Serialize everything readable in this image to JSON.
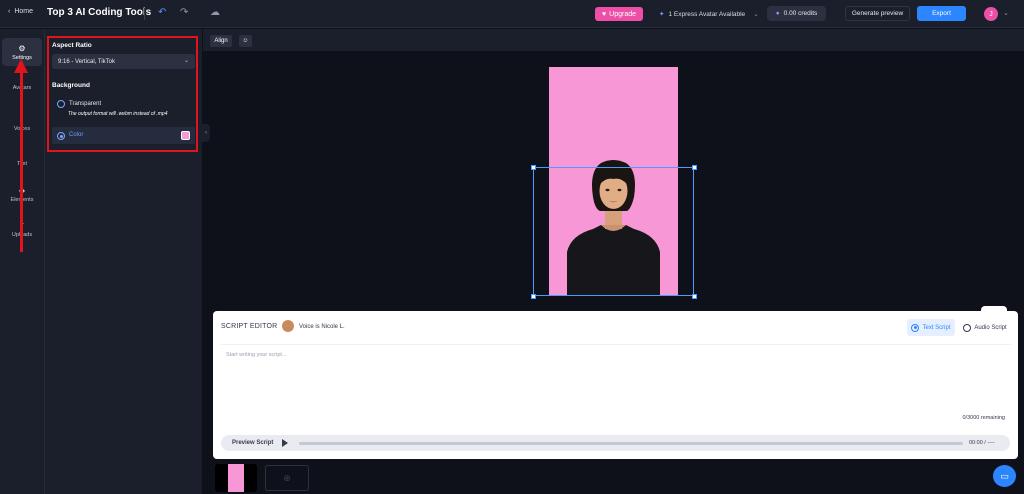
{
  "topbar": {
    "home_label": "Home",
    "title": "Top 3 AI Coding Tools",
    "upgrade_label": "Upgrade",
    "express_label": "1 Express Avatar Available",
    "credits_label": "0.00 credits",
    "generate_preview_label": "Generate preview",
    "export_label": "Export",
    "user_initial": "J"
  },
  "sidebar": {
    "items": [
      {
        "label": "Settings",
        "icon": "gear-icon"
      },
      {
        "label": "Avatars",
        "icon": "avatar-icon"
      },
      {
        "label": "Voices",
        "icon": "mic-icon"
      },
      {
        "label": "Text",
        "icon": "text-icon"
      },
      {
        "label": "Elements",
        "icon": "shapes-icon"
      },
      {
        "label": "Uploads",
        "icon": "upload-icon"
      }
    ]
  },
  "settings": {
    "aspect_ratio_label": "Aspect Ratio",
    "aspect_ratio_value": "9:16 - Vertical, TikTok",
    "background_label": "Background",
    "transparent_label": "Transparent",
    "transparent_note": "The output format will .webm instead of .mp4",
    "color_label": "Color",
    "selected_background": "Color",
    "color_value": "#f797d5"
  },
  "canvas": {
    "align_label": "Align"
  },
  "editor": {
    "title": "SCRIPT EDITOR",
    "voice_label": "Voice is Nicole L.",
    "text_script_label": "Text Script",
    "audio_script_label": "Audio Script",
    "selected_tab": "Text Script",
    "placeholder": "Start writing your script...",
    "remaining": "0/3000 remaining",
    "preview_label": "Preview Script",
    "timecode": "00:00 / ----"
  },
  "colors": {
    "accent": "#2b86ff",
    "brand_pink": "#ec4fa5",
    "highlight_red": "#e1141d"
  }
}
